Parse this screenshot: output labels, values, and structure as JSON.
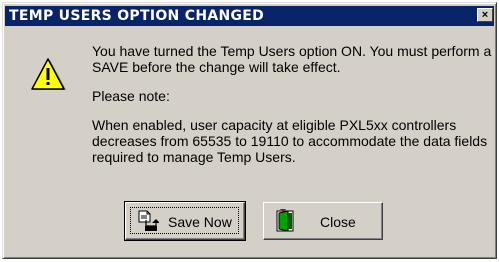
{
  "dialog": {
    "title": "TEMP USERS OPTION CHANGED",
    "close_glyph": "×"
  },
  "icon": "warning-icon",
  "message": {
    "line1": "You have turned the Temp Users option ON.  You must perform a SAVE before the change will take effect.",
    "line2": "Please note:",
    "line3": "When enabled, user capacity at eligible PXL5xx controllers decreases from 65535 to 19110 to accommodate the data fields required to manage Temp Users."
  },
  "buttons": {
    "save_now": {
      "label": "Save Now",
      "icon": "save-document-icon"
    },
    "close": {
      "label": "Close",
      "icon": "exit-door-icon"
    }
  },
  "colors": {
    "titlebar": "#0a246a",
    "window": "#d4d0c8",
    "warning": "#ffff00"
  }
}
